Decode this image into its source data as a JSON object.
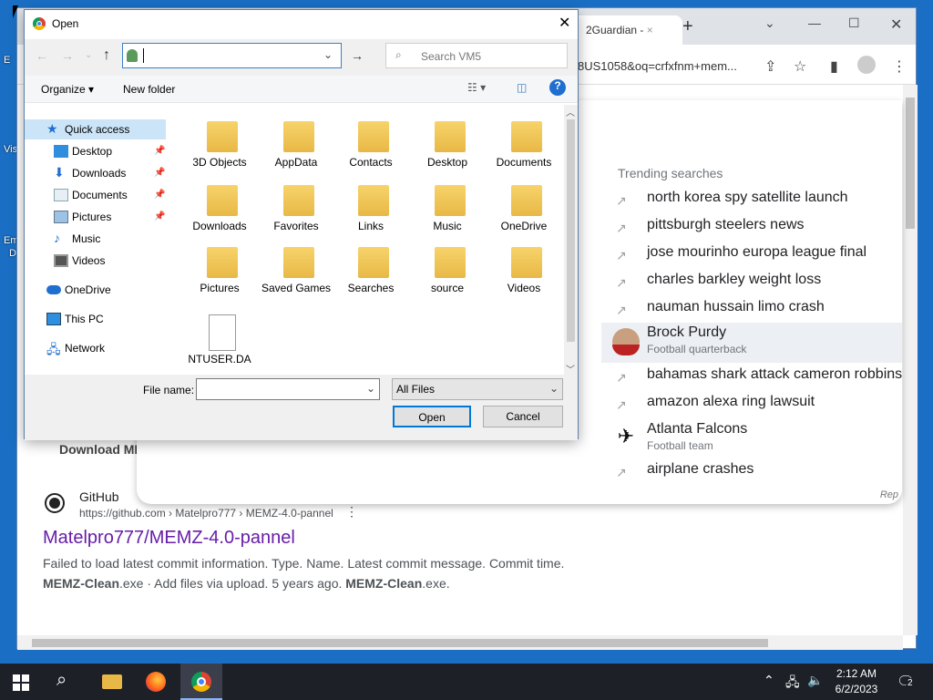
{
  "dialog": {
    "title": "Open",
    "path_value": "",
    "search_placeholder": "Search VM5",
    "toolbar": {
      "organize": "Organize ▾",
      "new_folder": "New folder"
    },
    "nav": [
      {
        "label": "Quick access",
        "icon": "star-icon",
        "pinned": false,
        "selected": true
      },
      {
        "label": "Desktop",
        "icon": "desktop-icon",
        "pinned": true
      },
      {
        "label": "Downloads",
        "icon": "downloads-icon",
        "pinned": true
      },
      {
        "label": "Documents",
        "icon": "documents-icon",
        "pinned": true
      },
      {
        "label": "Pictures",
        "icon": "pictures-icon",
        "pinned": true
      },
      {
        "label": "Music",
        "icon": "music-icon",
        "pinned": false
      },
      {
        "label": "Videos",
        "icon": "videos-icon",
        "pinned": false
      },
      {
        "label": "OneDrive",
        "icon": "onedrive-icon",
        "pinned": false
      },
      {
        "label": "This PC",
        "icon": "this-pc-icon",
        "pinned": false
      },
      {
        "label": "Network",
        "icon": "network-icon",
        "pinned": false
      }
    ],
    "files": [
      {
        "label": "3D Objects",
        "icon": "3d-objects-folder-icon"
      },
      {
        "label": "AppData",
        "icon": "appdata-folder-icon"
      },
      {
        "label": "Contacts",
        "icon": "contacts-folder-icon"
      },
      {
        "label": "Desktop",
        "icon": "desktop-folder-icon"
      },
      {
        "label": "Documents",
        "icon": "documents-folder-icon"
      },
      {
        "label": "Downloads",
        "icon": "downloads-folder-icon"
      },
      {
        "label": "Favorites",
        "icon": "favorites-folder-icon"
      },
      {
        "label": "Links",
        "icon": "links-folder-icon"
      },
      {
        "label": "Music",
        "icon": "music-folder-icon"
      },
      {
        "label": "OneDrive",
        "icon": "onedrive-folder-icon"
      },
      {
        "label": "Pictures",
        "icon": "pictures-folder-icon"
      },
      {
        "label": "Saved Games",
        "icon": "saved-games-folder-icon"
      },
      {
        "label": "Searches",
        "icon": "searches-folder-icon"
      },
      {
        "label": "source",
        "icon": "source-folder-icon"
      },
      {
        "label": "Videos",
        "icon": "videos-folder-icon"
      },
      {
        "label": "NTUSER.DA",
        "icon": "file-icon"
      }
    ],
    "file_name_label": "File name:",
    "file_name_value": "",
    "filter_value": "All Files",
    "open_label": "Open",
    "cancel_label": "Cancel"
  },
  "browser": {
    "tab_title": "2Guardian - ",
    "url": "8US1058&oq=crfxfnm+mem...",
    "trending_header": "Trending searches",
    "suggestions": [
      {
        "title": "north korea spy satellite launch",
        "sub": ""
      },
      {
        "title": "pittsburgh steelers news",
        "sub": ""
      },
      {
        "title": "jose mourinho europa league final",
        "sub": ""
      },
      {
        "title": "charles barkley weight loss",
        "sub": ""
      },
      {
        "title": "nauman hussain limo crash",
        "sub": ""
      },
      {
        "title": "Brock Purdy",
        "sub": "Football quarterback"
      },
      {
        "title": "bahamas shark attack cameron robbins",
        "sub": ""
      },
      {
        "title": "amazon alexa ring lawsuit",
        "sub": ""
      },
      {
        "title": "Atlanta Falcons",
        "sub": "Football team"
      },
      {
        "title": "airplane crashes",
        "sub": ""
      }
    ],
    "report": "Rep",
    "results": {
      "partial_title": "Download MEM",
      "site_name": "GitHub",
      "site_url": "https://github.com › Matelpro777 › MEMZ-4.0-pannel",
      "link_title": "Matelpro777/MEMZ-4.0-pannel",
      "snippet1": "Failed to load latest commit information. Type. Name. Latest commit message. Commit time.",
      "snippet2_b1": "MEMZ-Clean",
      "snippet2_t1": ".exe · Add files via upload. 5 years ago. ",
      "snippet2_b2": "MEMZ-Clean",
      "snippet2_t2": ".exe."
    }
  },
  "desktop": {
    "icon_labels": [
      "E",
      "Vis",
      "Em",
      "D"
    ]
  },
  "taskbar": {
    "time": "2:12 AM",
    "date": "6/2/2023",
    "notification_count": "2"
  },
  "colors": {
    "accent": "#0067c0",
    "link_visited": "#681da8",
    "taskbar": "#1d2027"
  }
}
